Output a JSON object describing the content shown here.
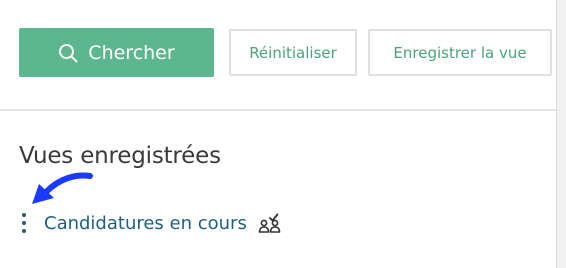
{
  "toolbar": {
    "search_label": "Chercher",
    "reset_label": "Réinitialiser",
    "save_view_label": "Enregistrer la vue"
  },
  "saved_views": {
    "title": "Vues enregistrées",
    "items": [
      {
        "label": "Candidatures en cours",
        "icon": "shared-users-check-icon"
      }
    ]
  },
  "colors": {
    "primary": "#5cb78f",
    "link": "#1f5f80",
    "annotation": "#1a3bff"
  }
}
